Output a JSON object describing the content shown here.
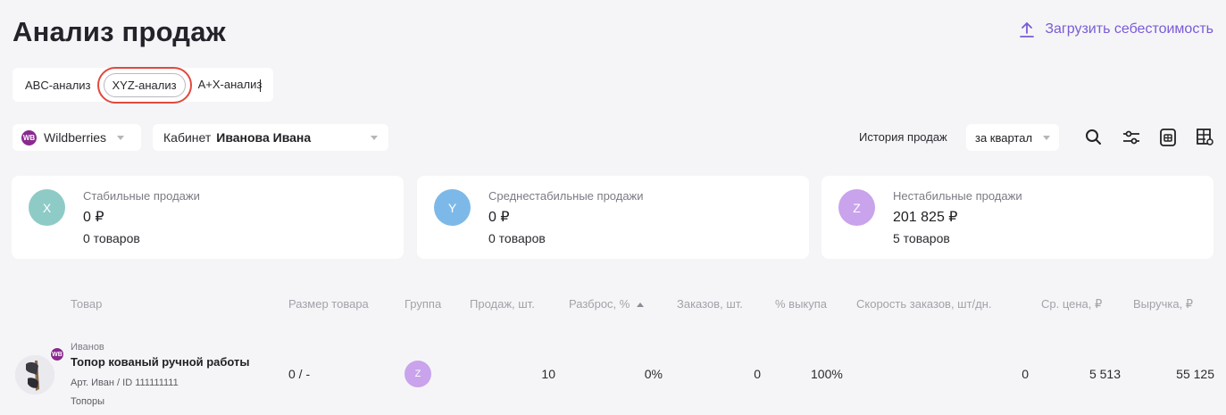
{
  "header": {
    "title": "Анализ продаж",
    "upload_label": "Загрузить себестоимость"
  },
  "tabs": [
    {
      "label": "ABC-анализ",
      "active": false
    },
    {
      "label": "XYZ-анализ",
      "active": true
    },
    {
      "label": "A+X-анализ",
      "active": false
    }
  ],
  "filters": {
    "marketplace": "Wildberries",
    "marketplace_badge": "WB",
    "cabinet_label": "Кабинет",
    "cabinet_value": "Иванова Ивана",
    "history_label": "История продаж",
    "period": "за квартал"
  },
  "tools": [
    "search-icon",
    "filter-sliders-icon",
    "excel-export-icon",
    "table-settings-icon"
  ],
  "cards": [
    {
      "letter": "X",
      "label": "Стабильные продажи",
      "value": "0 ₽",
      "count": "0 товаров",
      "color": "#8fcbc6"
    },
    {
      "letter": "Y",
      "label": "Среднестабильные продажи",
      "value": "0 ₽",
      "count": "0 товаров",
      "color": "#7db9e8"
    },
    {
      "letter": "Z",
      "label": "Нестабильные продажи",
      "value": "201 825 ₽",
      "count": "5 товаров",
      "color": "#c9a3ec"
    }
  ],
  "columns": [
    "Товар",
    "Размер товара",
    "Группа",
    "Продаж, шт.",
    "Разброс, %",
    "Заказов, шт.",
    "% выкупа",
    "Скорость заказов, шт/дн.",
    "Ср. цена, ₽",
    "Выручка, ₽"
  ],
  "rows": [
    {
      "brand": "Иванов",
      "name": "Топор кованый ручной работы",
      "article": "Арт. Иван / ID 111111111",
      "category": "Топоры",
      "size": "0 / -",
      "group": "Z",
      "sales": "10",
      "spread": "0%",
      "orders": "0",
      "buyout": "100%",
      "speed": "0",
      "avg_price": "5 513",
      "revenue": "55 125"
    }
  ]
}
